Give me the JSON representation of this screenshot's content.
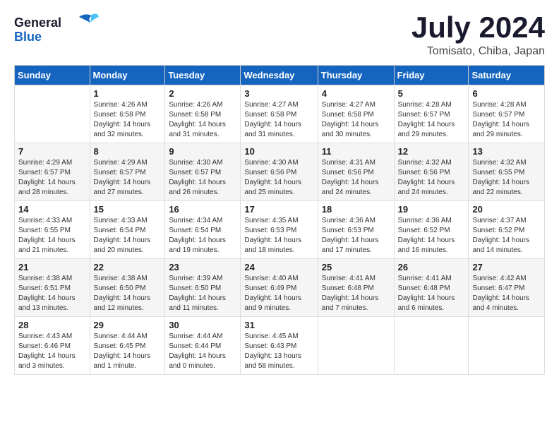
{
  "header": {
    "logo_line1": "General",
    "logo_line2": "Blue",
    "title": "July 2024",
    "location": "Tomisato, Chiba, Japan"
  },
  "days_of_week": [
    "Sunday",
    "Monday",
    "Tuesday",
    "Wednesday",
    "Thursday",
    "Friday",
    "Saturday"
  ],
  "weeks": [
    [
      {
        "day": "",
        "info": ""
      },
      {
        "day": "1",
        "info": "Sunrise: 4:26 AM\nSunset: 6:58 PM\nDaylight: 14 hours\nand 32 minutes."
      },
      {
        "day": "2",
        "info": "Sunrise: 4:26 AM\nSunset: 6:58 PM\nDaylight: 14 hours\nand 31 minutes."
      },
      {
        "day": "3",
        "info": "Sunrise: 4:27 AM\nSunset: 6:58 PM\nDaylight: 14 hours\nand 31 minutes."
      },
      {
        "day": "4",
        "info": "Sunrise: 4:27 AM\nSunset: 6:58 PM\nDaylight: 14 hours\nand 30 minutes."
      },
      {
        "day": "5",
        "info": "Sunrise: 4:28 AM\nSunset: 6:57 PM\nDaylight: 14 hours\nand 29 minutes."
      },
      {
        "day": "6",
        "info": "Sunrise: 4:28 AM\nSunset: 6:57 PM\nDaylight: 14 hours\nand 29 minutes."
      }
    ],
    [
      {
        "day": "7",
        "info": "Sunrise: 4:29 AM\nSunset: 6:57 PM\nDaylight: 14 hours\nand 28 minutes."
      },
      {
        "day": "8",
        "info": "Sunrise: 4:29 AM\nSunset: 6:57 PM\nDaylight: 14 hours\nand 27 minutes."
      },
      {
        "day": "9",
        "info": "Sunrise: 4:30 AM\nSunset: 6:57 PM\nDaylight: 14 hours\nand 26 minutes."
      },
      {
        "day": "10",
        "info": "Sunrise: 4:30 AM\nSunset: 6:56 PM\nDaylight: 14 hours\nand 25 minutes."
      },
      {
        "day": "11",
        "info": "Sunrise: 4:31 AM\nSunset: 6:56 PM\nDaylight: 14 hours\nand 24 minutes."
      },
      {
        "day": "12",
        "info": "Sunrise: 4:32 AM\nSunset: 6:56 PM\nDaylight: 14 hours\nand 24 minutes."
      },
      {
        "day": "13",
        "info": "Sunrise: 4:32 AM\nSunset: 6:55 PM\nDaylight: 14 hours\nand 22 minutes."
      }
    ],
    [
      {
        "day": "14",
        "info": "Sunrise: 4:33 AM\nSunset: 6:55 PM\nDaylight: 14 hours\nand 21 minutes."
      },
      {
        "day": "15",
        "info": "Sunrise: 4:33 AM\nSunset: 6:54 PM\nDaylight: 14 hours\nand 20 minutes."
      },
      {
        "day": "16",
        "info": "Sunrise: 4:34 AM\nSunset: 6:54 PM\nDaylight: 14 hours\nand 19 minutes."
      },
      {
        "day": "17",
        "info": "Sunrise: 4:35 AM\nSunset: 6:53 PM\nDaylight: 14 hours\nand 18 minutes."
      },
      {
        "day": "18",
        "info": "Sunrise: 4:36 AM\nSunset: 6:53 PM\nDaylight: 14 hours\nand 17 minutes."
      },
      {
        "day": "19",
        "info": "Sunrise: 4:36 AM\nSunset: 6:52 PM\nDaylight: 14 hours\nand 16 minutes."
      },
      {
        "day": "20",
        "info": "Sunrise: 4:37 AM\nSunset: 6:52 PM\nDaylight: 14 hours\nand 14 minutes."
      }
    ],
    [
      {
        "day": "21",
        "info": "Sunrise: 4:38 AM\nSunset: 6:51 PM\nDaylight: 14 hours\nand 13 minutes."
      },
      {
        "day": "22",
        "info": "Sunrise: 4:38 AM\nSunset: 6:50 PM\nDaylight: 14 hours\nand 12 minutes."
      },
      {
        "day": "23",
        "info": "Sunrise: 4:39 AM\nSunset: 6:50 PM\nDaylight: 14 hours\nand 11 minutes."
      },
      {
        "day": "24",
        "info": "Sunrise: 4:40 AM\nSunset: 6:49 PM\nDaylight: 14 hours\nand 9 minutes."
      },
      {
        "day": "25",
        "info": "Sunrise: 4:41 AM\nSunset: 6:48 PM\nDaylight: 14 hours\nand 7 minutes."
      },
      {
        "day": "26",
        "info": "Sunrise: 4:41 AM\nSunset: 6:48 PM\nDaylight: 14 hours\nand 6 minutes."
      },
      {
        "day": "27",
        "info": "Sunrise: 4:42 AM\nSunset: 6:47 PM\nDaylight: 14 hours\nand 4 minutes."
      }
    ],
    [
      {
        "day": "28",
        "info": "Sunrise: 4:43 AM\nSunset: 6:46 PM\nDaylight: 14 hours\nand 3 minutes."
      },
      {
        "day": "29",
        "info": "Sunrise: 4:44 AM\nSunset: 6:45 PM\nDaylight: 14 hours\nand 1 minute."
      },
      {
        "day": "30",
        "info": "Sunrise: 4:44 AM\nSunset: 6:44 PM\nDaylight: 14 hours\nand 0 minutes."
      },
      {
        "day": "31",
        "info": "Sunrise: 4:45 AM\nSunset: 6:43 PM\nDaylight: 13 hours\nand 58 minutes."
      },
      {
        "day": "",
        "info": ""
      },
      {
        "day": "",
        "info": ""
      },
      {
        "day": "",
        "info": ""
      }
    ]
  ]
}
